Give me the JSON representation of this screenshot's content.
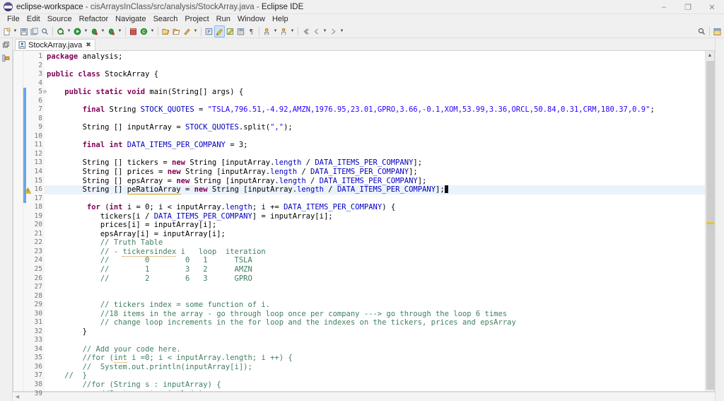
{
  "window": {
    "app_name": "eclipse-workspace",
    "document_path": "cisArraysInClass/src/analysis/StockArray.java",
    "ide_name": "Eclipse IDE",
    "title_separator": " - ",
    "minimize_label": "–",
    "restore_label": "❐",
    "close_label": "✕"
  },
  "menu": {
    "items": [
      {
        "label": "File"
      },
      {
        "label": "Edit"
      },
      {
        "label": "Source"
      },
      {
        "label": "Refactor"
      },
      {
        "label": "Navigate"
      },
      {
        "label": "Search"
      },
      {
        "label": "Project"
      },
      {
        "label": "Run"
      },
      {
        "label": "Window"
      },
      {
        "label": "Help"
      }
    ]
  },
  "toolbar": {
    "groups": [
      {
        "buttons": [
          {
            "name": "new-wizard-icon",
            "caret": true
          },
          {
            "name": "save-icon",
            "caret": false
          },
          {
            "name": "save-all-icon",
            "caret": false
          },
          {
            "name": "quick-access-search-icon",
            "caret": false
          }
        ]
      },
      {
        "buttons": [
          {
            "name": "build-icon",
            "caret": true
          },
          {
            "name": "run-icon",
            "caret": true
          },
          {
            "name": "debug-icon",
            "caret": true
          },
          {
            "name": "run-last-tool-icon",
            "caret": true
          }
        ]
      },
      {
        "buttons": [
          {
            "name": "new-java-package-icon",
            "caret": false
          },
          {
            "name": "new-java-class-icon",
            "caret": true
          }
        ]
      },
      {
        "buttons": [
          {
            "name": "open-type-icon",
            "caret": false
          },
          {
            "name": "open-task-icon",
            "caret": false
          },
          {
            "name": "search-icon",
            "caret": true
          }
        ]
      },
      {
        "buttons": [
          {
            "name": "toggle-mark-occurrences-icon",
            "caret": false
          },
          {
            "name": "toggle-whitespace-icon",
            "caret": false,
            "selected": true
          },
          {
            "name": "toggle-block-selection-icon",
            "caret": false
          },
          {
            "name": "skip-breakpoints-icon",
            "caret": false
          },
          {
            "name": "pilcrow-icon",
            "caret": false
          }
        ]
      },
      {
        "buttons": [
          {
            "name": "next-annotation-icon",
            "caret": true
          },
          {
            "name": "previous-annotation-icon",
            "caret": true
          }
        ]
      },
      {
        "buttons": [
          {
            "name": "last-edit-location-icon",
            "caret": false
          },
          {
            "name": "back-icon",
            "caret": true
          },
          {
            "name": "forward-icon",
            "caret": true
          }
        ]
      }
    ],
    "right_buttons": [
      {
        "name": "quick-access-icon"
      },
      {
        "name": "open-perspective-icon"
      }
    ],
    "right_row2": [
      {
        "name": "minimize-view-icon"
      },
      {
        "name": "maximize-view-icon"
      }
    ]
  },
  "fastview": {
    "items": [
      {
        "name": "restore-view-icon"
      },
      {
        "name": "package-explorer-icon"
      }
    ]
  },
  "editor": {
    "tab": {
      "label": "StockArray.java",
      "icon": "java-file-icon",
      "close_label": "✖"
    },
    "current_line": 16,
    "warning_line": 16,
    "change_bar_from": 5,
    "change_bar_to": 17,
    "first_visible_line": 1,
    "last_visible_line": 39,
    "folding_lines": [
      5
    ],
    "scroll": {
      "up_arrow": "▲",
      "left_arrow": "◀",
      "warning_marker": true
    }
  },
  "code_lines": [
    {
      "n": 1,
      "tokens": [
        {
          "t": "package ",
          "c": "kw"
        },
        {
          "t": "analysis;",
          "c": "pl"
        }
      ]
    },
    {
      "n": 2,
      "tokens": []
    },
    {
      "n": 3,
      "tokens": [
        {
          "t": "public class ",
          "c": "kw"
        },
        {
          "t": "StockArray {",
          "c": "pl"
        }
      ]
    },
    {
      "n": 4,
      "tokens": []
    },
    {
      "n": 5,
      "tokens": [
        {
          "t": "    ",
          "c": "pl"
        },
        {
          "t": "public static void ",
          "c": "kw"
        },
        {
          "t": "main(String[] args) {",
          "c": "pl"
        }
      ]
    },
    {
      "n": 6,
      "tokens": []
    },
    {
      "n": 7,
      "tokens": [
        {
          "t": "        ",
          "c": "pl"
        },
        {
          "t": "final ",
          "c": "kw"
        },
        {
          "t": "String ",
          "c": "pl"
        },
        {
          "t": "STOCK_QUOTES",
          "c": "fld"
        },
        {
          "t": " = ",
          "c": "pl"
        },
        {
          "t": "\"TSLA,796.51,-4.92,AMZN,1976.95,23.01,GPRO,3.66,-0.1,XOM,53.99,3.36,ORCL,50.84,0.31,CRM,180.37,0.9\"",
          "c": "str"
        },
        {
          "t": ";",
          "c": "pl"
        }
      ]
    },
    {
      "n": 8,
      "tokens": []
    },
    {
      "n": 9,
      "tokens": [
        {
          "t": "        String [] inputArray = ",
          "c": "pl"
        },
        {
          "t": "STOCK_QUOTES",
          "c": "fld"
        },
        {
          "t": ".split(",
          "c": "pl"
        },
        {
          "t": "\",\"",
          "c": "str"
        },
        {
          "t": ");",
          "c": "pl"
        }
      ]
    },
    {
      "n": 10,
      "tokens": []
    },
    {
      "n": 11,
      "tokens": [
        {
          "t": "        ",
          "c": "pl"
        },
        {
          "t": "final int ",
          "c": "kw"
        },
        {
          "t": "DATA_ITEMS_PER_COMPANY",
          "c": "fld"
        },
        {
          "t": " = 3;",
          "c": "pl"
        }
      ]
    },
    {
      "n": 12,
      "tokens": []
    },
    {
      "n": 13,
      "tokens": [
        {
          "t": "        String [] tickers = ",
          "c": "pl"
        },
        {
          "t": "new ",
          "c": "kw"
        },
        {
          "t": "String [inputArray.",
          "c": "pl"
        },
        {
          "t": "length",
          "c": "fld"
        },
        {
          "t": " / ",
          "c": "pl"
        },
        {
          "t": "DATA_ITEMS_PER_COMPANY",
          "c": "fld"
        },
        {
          "t": "];",
          "c": "pl"
        }
      ]
    },
    {
      "n": 14,
      "tokens": [
        {
          "t": "        String [] prices = ",
          "c": "pl"
        },
        {
          "t": "new ",
          "c": "kw"
        },
        {
          "t": "String [inputArray.",
          "c": "pl"
        },
        {
          "t": "length",
          "c": "fld"
        },
        {
          "t": " / ",
          "c": "pl"
        },
        {
          "t": "DATA_ITEMS_PER_COMPANY",
          "c": "fld"
        },
        {
          "t": "];",
          "c": "pl"
        }
      ]
    },
    {
      "n": 15,
      "tokens": [
        {
          "t": "        String [] epsArray = ",
          "c": "pl"
        },
        {
          "t": "new ",
          "c": "kw"
        },
        {
          "t": "String [inputArray.",
          "c": "pl"
        },
        {
          "t": "length",
          "c": "fld"
        },
        {
          "t": " / ",
          "c": "pl"
        },
        {
          "t": "DATA_ITEMS_PER_COMPANY",
          "c": "fld"
        },
        {
          "t": "];",
          "c": "pl"
        }
      ]
    },
    {
      "n": 16,
      "tokens": [
        {
          "t": "        String [] ",
          "c": "pl"
        },
        {
          "t": "peRatioArray",
          "c": "pl sq2"
        },
        {
          "t": " = ",
          "c": "pl"
        },
        {
          "t": "new ",
          "c": "kw"
        },
        {
          "t": "String [inputArray.",
          "c": "pl"
        },
        {
          "t": "length",
          "c": "fld"
        },
        {
          "t": " / ",
          "c": "pl"
        },
        {
          "t": "DATA_ITEMS_PER_COMPANY",
          "c": "fld"
        },
        {
          "t": "];",
          "c": "pl"
        },
        {
          "t": "",
          "c": "cursor"
        }
      ]
    },
    {
      "n": 17,
      "tokens": []
    },
    {
      "n": 18,
      "tokens": [
        {
          "t": "         ",
          "c": "pl"
        },
        {
          "t": "for ",
          "c": "kw"
        },
        {
          "t": "(",
          "c": "pl"
        },
        {
          "t": "int ",
          "c": "kw"
        },
        {
          "t": "i = 0; i < inputArray.",
          "c": "pl"
        },
        {
          "t": "length",
          "c": "fld"
        },
        {
          "t": "; i += ",
          "c": "pl"
        },
        {
          "t": "DATA_ITEMS_PER_COMPANY",
          "c": "fld"
        },
        {
          "t": ") {",
          "c": "pl"
        }
      ]
    },
    {
      "n": 19,
      "tokens": [
        {
          "t": "            tickers[i / ",
          "c": "pl"
        },
        {
          "t": "DATA_ITEMS_PER_COMPANY",
          "c": "fld"
        },
        {
          "t": "] = inputArray[i];",
          "c": "pl"
        }
      ]
    },
    {
      "n": 20,
      "tokens": [
        {
          "t": "            prices[i] = inputArray[i];",
          "c": "pl"
        }
      ]
    },
    {
      "n": 21,
      "tokens": [
        {
          "t": "            epsArray[i] = inputArray[i];",
          "c": "pl"
        }
      ]
    },
    {
      "n": 22,
      "tokens": [
        {
          "t": "            // Truth Table",
          "c": "cm"
        }
      ]
    },
    {
      "n": 23,
      "tokens": [
        {
          "t": "            // - ",
          "c": "cm"
        },
        {
          "t": "tickersindex",
          "c": "cm sq"
        },
        {
          "t": " i   loop  iteration",
          "c": "cm"
        }
      ]
    },
    {
      "n": 24,
      "tokens": [
        {
          "t": "            //        0        0   1      TSLA",
          "c": "cm"
        }
      ]
    },
    {
      "n": 25,
      "tokens": [
        {
          "t": "            //        1        3   2      AMZN",
          "c": "cm"
        }
      ]
    },
    {
      "n": 26,
      "tokens": [
        {
          "t": "            //        2        6   3      GPRO",
          "c": "cm"
        }
      ]
    },
    {
      "n": 27,
      "tokens": []
    },
    {
      "n": 28,
      "tokens": []
    },
    {
      "n": 29,
      "tokens": [
        {
          "t": "            // tickers index = some function of i.",
          "c": "cm"
        }
      ]
    },
    {
      "n": 30,
      "tokens": [
        {
          "t": "            //18 items in the array - go through loop once per company ---> go through the loop 6 times",
          "c": "cm"
        }
      ]
    },
    {
      "n": 31,
      "tokens": [
        {
          "t": "            // change loop increments in the for loop and the indexes on the tickers, prices and epsArray",
          "c": "cm"
        }
      ]
    },
    {
      "n": 32,
      "tokens": [
        {
          "t": "        }",
          "c": "pl"
        }
      ]
    },
    {
      "n": 33,
      "tokens": []
    },
    {
      "n": 34,
      "tokens": [
        {
          "t": "        // Add your code here.",
          "c": "cm"
        }
      ]
    },
    {
      "n": 35,
      "tokens": [
        {
          "t": "        //for (",
          "c": "cm"
        },
        {
          "t": "int",
          "c": "cm sq"
        },
        {
          "t": " i =0; i < inputArray.length; i ++) {",
          "c": "cm"
        }
      ]
    },
    {
      "n": 36,
      "tokens": [
        {
          "t": "        //  System.out.println(inputArray[i]);",
          "c": "cm"
        }
      ]
    },
    {
      "n": 37,
      "tokens": [
        {
          "t": "    //  }",
          "c": "cm"
        }
      ]
    },
    {
      "n": 38,
      "tokens": [
        {
          "t": "        //for (String s : inputArray) {",
          "c": "cm"
        }
      ]
    },
    {
      "n": 39,
      "tokens": [
        {
          "t": "            //System.out.println(s);",
          "c": "cm"
        }
      ]
    }
  ],
  "colors": {
    "keyword": "#7f0055",
    "string": "#2a00ff",
    "comment": "#3f7f5f",
    "field": "#0000c0",
    "current_line_bg": "#eaf2fb",
    "change_bar": "#69a6e8",
    "chrome_bg": "#f0f0f0"
  }
}
